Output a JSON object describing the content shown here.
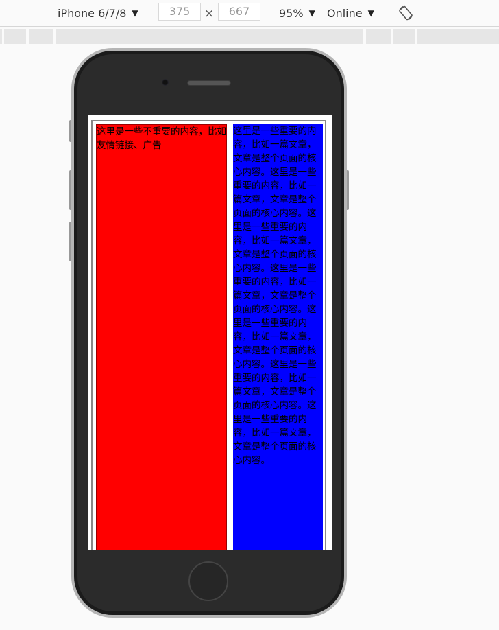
{
  "toolbar": {
    "device_label": "iPhone 6/7/8",
    "width_value": "375",
    "height_value": "667",
    "times_sign": "×",
    "zoom_label": "95%",
    "network_label": "Online"
  },
  "page": {
    "left_text": "这里是一些不重要的内容，比如友情链接、广告",
    "right_text": "这里是一些重要的内容，比如一篇文章，文章是整个页面的核心内容。这里是一些重要的内容，比如一篇文章，文章是整个页面的核心内容。这里是一些重要的内容，比如一篇文章，文章是整个页面的核心内容。这里是一些重要的内容，比如一篇文章，文章是整个页面的核心内容。这里是一些重要的内容，比如一篇文章，文章是整个页面的核心内容。这里是一些重要的内容，比如一篇文章，文章是整个页面的核心内容。这里是一些重要的内容，比如一篇文章，文章是整个页面的核心内容。",
    "left_color": "#ff0000",
    "right_color": "#0000ff"
  },
  "icons": {
    "dropdown": "caret-down-icon",
    "rotate": "rotate-icon"
  }
}
